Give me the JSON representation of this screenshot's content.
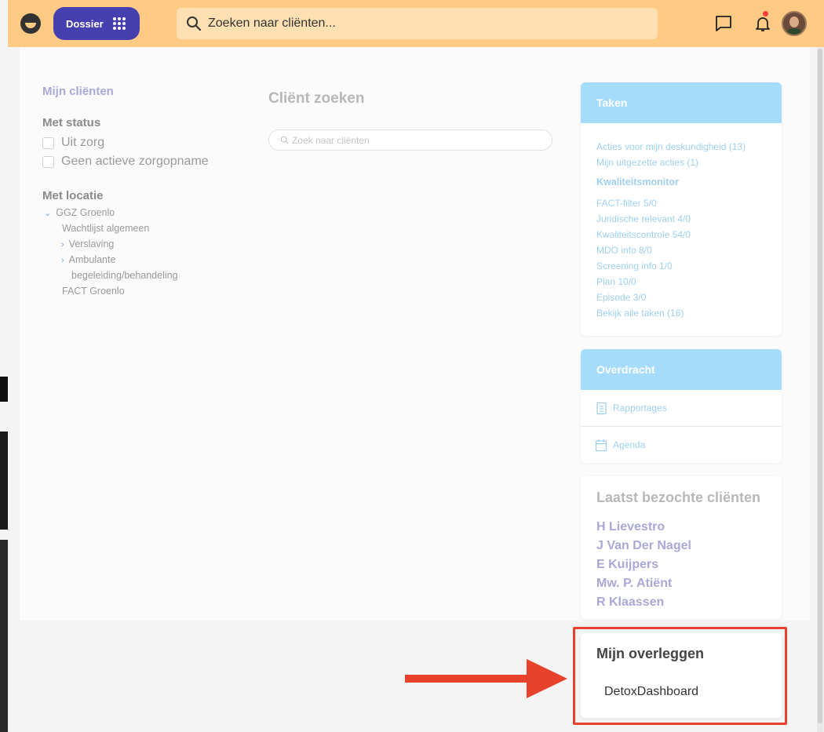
{
  "header": {
    "app_button_label": "Dossier",
    "search_placeholder": "Zoeken naar cliënten..."
  },
  "filters": {
    "mine_label": "Mijn cliënten",
    "status_heading": "Met status",
    "status_options": [
      "Uit zorg",
      "Geen actieve zorgopname"
    ],
    "location_heading": "Met locatie",
    "locations": {
      "root": "GGZ Groenlo",
      "wachtlijst": "Wachtlijst algemeen",
      "verslaving": "Verslaving",
      "ambulante_1": "Ambulante",
      "ambulante_2": "begeleiding/behandeling",
      "fact": "FACT Groenlo"
    }
  },
  "center": {
    "title": "Cliënt zoeken",
    "search_placeholder": "Zoek naar cliënten"
  },
  "taken": {
    "title": "Taken",
    "links": [
      "Acties voor mijn deskundigheid (13)",
      "Mijn uitgezette acties (1)"
    ],
    "subheading": "Kwaliteitsmonitor",
    "monitor": [
      "FACT-filter 5/0",
      "Juridische relevant 4/0",
      "Kwaliteitscontrole 54/0",
      "MDO info 8/0",
      "Screening info 1/0",
      "Plan 10/0",
      "Episode 3/0",
      "Bekijk alle taken (16)"
    ]
  },
  "overdracht": {
    "title": "Overdracht",
    "items": [
      "Rapportages",
      "Agenda"
    ]
  },
  "recent": {
    "title": "Laatst bezochte cliënten",
    "clients": [
      "H Lievestro",
      "J Van Der Nagel",
      "E Kuijpers",
      "Mw. P. Atiënt",
      "R Klaassen"
    ]
  },
  "overleggen": {
    "title": "Mijn overleggen",
    "items": [
      "DetoxDashboard"
    ]
  },
  "colors": {
    "header": "#ffca84",
    "accent": "#463fb0",
    "card_head": "#a6dcfb",
    "link": "#9fd0ef",
    "annotation": "#e8412c"
  }
}
